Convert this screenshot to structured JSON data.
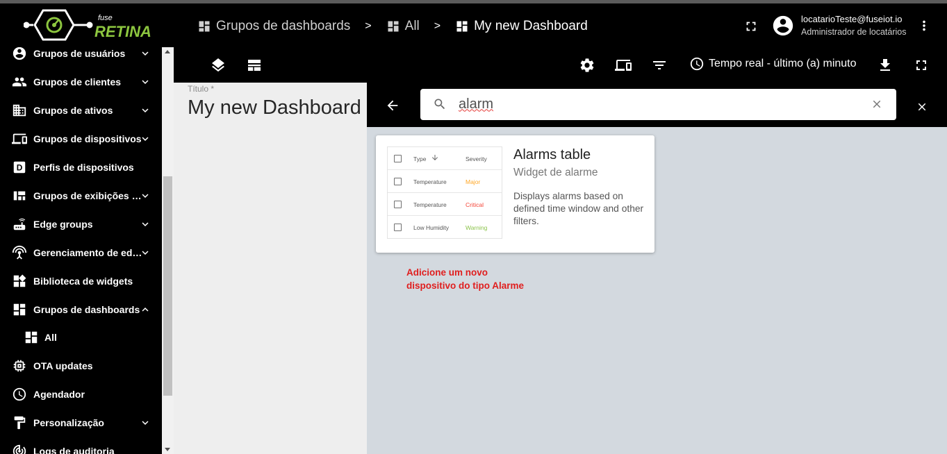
{
  "app": {
    "logo_text": "fuse RETINA",
    "brand_color": "#8dc63f"
  },
  "breadcrumb": [
    {
      "label": "Grupos de dashboards",
      "icon": "dashboard-grid-icon"
    },
    {
      "label": "All",
      "icon": "dashboard-grid-icon"
    },
    {
      "label": "My new Dashboard",
      "icon": "dashboard-grid-icon"
    }
  ],
  "breadcrumb_separator": ">",
  "user": {
    "email": "locatarioTeste@fuseiot.io",
    "role": "Administrador de locatários"
  },
  "sidebar": {
    "items": [
      {
        "label": "Grupos de usuários",
        "icon": "account-circle-icon",
        "expandable": true
      },
      {
        "label": "Grupos de clientes",
        "icon": "people-icon",
        "expandable": true
      },
      {
        "label": "Grupos de ativos",
        "icon": "domain-icon",
        "expandable": true
      },
      {
        "label": "Grupos de dispositivos",
        "icon": "devices-icon",
        "expandable": true
      },
      {
        "label": "Perfis de dispositivos",
        "icon": "device-profile-icon",
        "expandable": false
      },
      {
        "label": "Grupos de exibições de entidades",
        "icon": "view-quilt-icon",
        "expandable": true
      },
      {
        "label": "Edge groups",
        "icon": "router-icon",
        "expandable": true
      },
      {
        "label": "Gerenciamento de edge",
        "icon": "settings-input-antenna-icon",
        "expandable": true
      },
      {
        "label": "Biblioteca de widgets",
        "icon": "widgets-icon",
        "expandable": false
      },
      {
        "label": "Grupos de dashboards",
        "icon": "dashboard-grid-icon",
        "expandable": true,
        "expanded": true
      },
      {
        "label": "All",
        "icon": "dashboard-grid-icon",
        "sub": true
      },
      {
        "label": "OTA updates",
        "icon": "memory-icon",
        "expandable": false
      },
      {
        "label": "Agendador",
        "icon": "schedule-icon",
        "expandable": false
      },
      {
        "label": "Personalização",
        "icon": "format-paint-icon",
        "expandable": true
      },
      {
        "label": "Logs de auditoria",
        "icon": "track-changes-icon",
        "expandable": false
      }
    ]
  },
  "toolbar": {
    "time_label": "Tempo real - último (a) minuto"
  },
  "dashboard": {
    "title_label": "Título *",
    "title_value": "My new Dashboard"
  },
  "widget_search": {
    "query": "alarm"
  },
  "widget_card": {
    "title": "Alarms table",
    "subtitle": "Widget de alarme",
    "description": "Displays alarms based on defined time window and other filters.",
    "preview": {
      "headers": {
        "type": "Type",
        "severity": "Severity"
      },
      "rows": [
        {
          "type": "Temperature",
          "severity": "Major",
          "color": "#ffa726"
        },
        {
          "type": "Temperature",
          "severity": "Critical",
          "color": "#f44336"
        },
        {
          "type": "Low Humidity",
          "severity": "Warning",
          "color": "#8bc34a"
        }
      ]
    }
  },
  "annotation": {
    "line1": "Adicione um novo",
    "line2": "dispositivo do tipo Alarme",
    "color": "#e01e1e"
  }
}
